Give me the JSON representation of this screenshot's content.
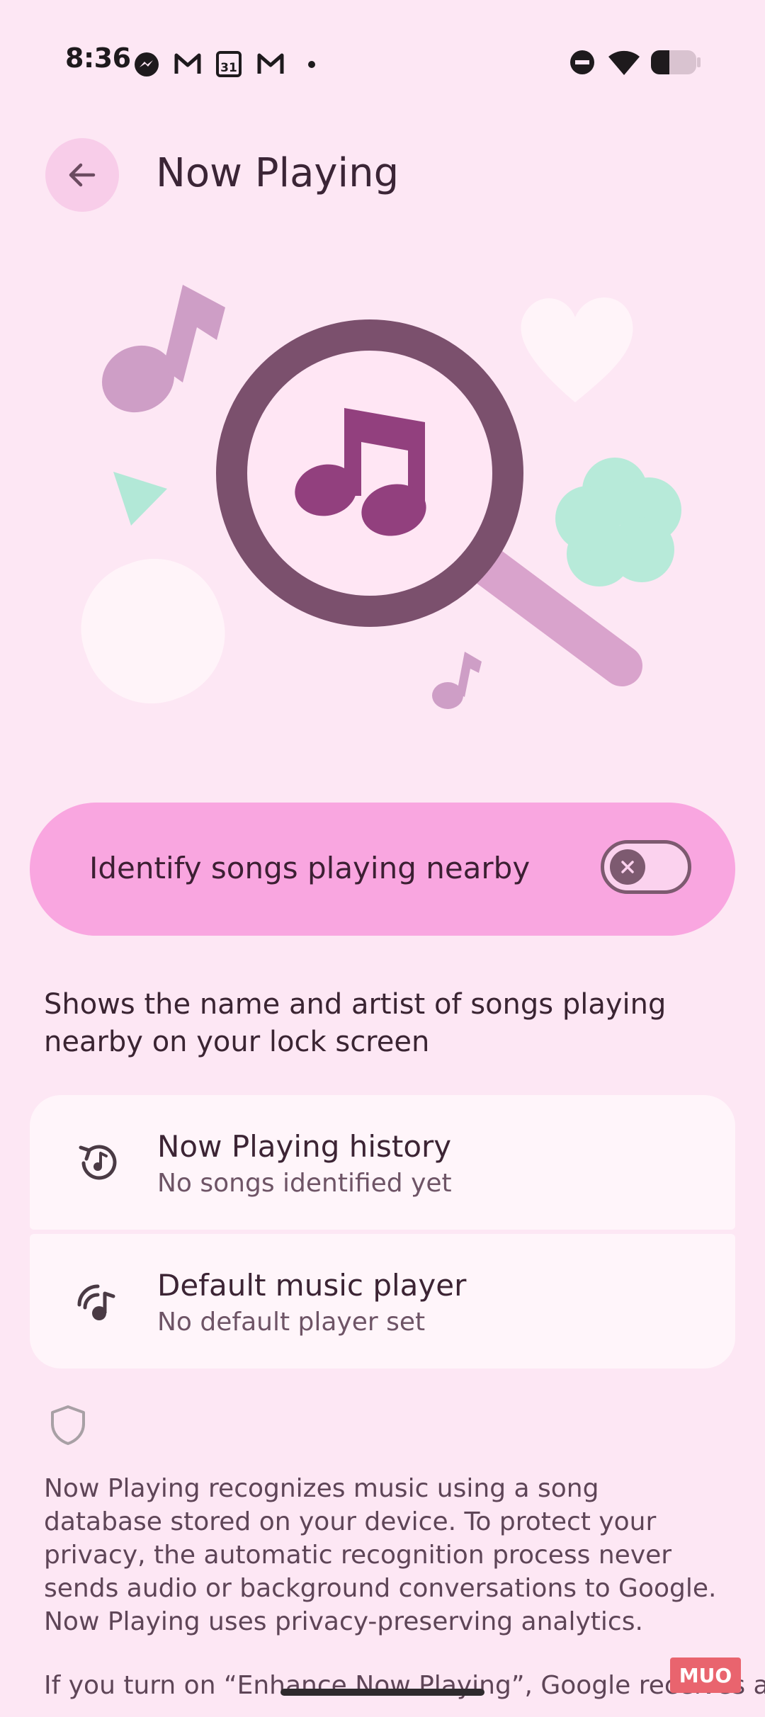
{
  "status_bar": {
    "time": "8:36",
    "left_icons": [
      "messenger-icon",
      "gmail-icon",
      "calendar-icon",
      "gmail-icon",
      "dot-icon"
    ],
    "calendar_day": "31",
    "right_icons": [
      "do-not-disturb-icon",
      "wifi-icon",
      "battery-icon"
    ],
    "battery_level": 0.4
  },
  "header": {
    "back_icon": "arrow-back-icon",
    "title": "Now Playing"
  },
  "main_toggle": {
    "label": "Identify songs playing nearby",
    "enabled": false
  },
  "description": "Shows the name and artist of songs playing nearby on your lock screen",
  "settings": [
    {
      "icon": "history-music-icon",
      "title": "Now Playing history",
      "subtitle": "No songs identified yet"
    },
    {
      "icon": "music-player-cast-icon",
      "title": "Default music player",
      "subtitle": "No default player set"
    }
  ],
  "privacy": {
    "icon": "shield-icon",
    "text": "Now Playing recognizes music using a song database stored on your device. To protect your privacy, the automatic recognition process never sends audio or background conversations to Google. Now Playing uses privacy-preserving analytics.",
    "more_text": "If you turn on “Enhance Now Playing”, Google receives a"
  },
  "watermark": "MUO",
  "colors": {
    "background": "#FDE7F4",
    "toggle_bg": "#F9A6E0",
    "card_bg": "#FFF5FA",
    "accent_dark": "#7D5A70"
  }
}
